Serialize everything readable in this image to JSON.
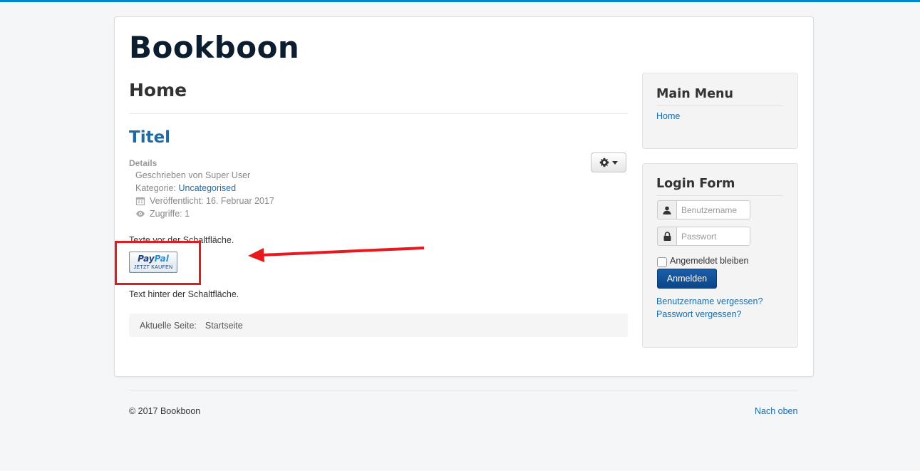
{
  "site": {
    "brand": "Bookboon"
  },
  "page": {
    "heading": "Home"
  },
  "article": {
    "title": "Titel",
    "details_label": "Details",
    "author_line": "Geschrieben von Super User",
    "category_prefix": "Kategorie: ",
    "category_link": "Uncategorised",
    "published": "Veröffentlicht: 16. Februar 2017",
    "hits": "Zugriffe: 1",
    "text_before": "Texte vor der Schaltfläche.",
    "paypal": {
      "logo_pay": "Pay",
      "logo_pal": "Pal",
      "caption": "JETZT KAUFEN"
    },
    "text_after": "Text hinter der Schaltfläche."
  },
  "breadcrumb": {
    "label": "Aktuelle Seite:",
    "current": "Startseite"
  },
  "main_menu": {
    "title": "Main Menu",
    "items": [
      {
        "label": "Home"
      }
    ]
  },
  "login_form": {
    "title": "Login Form",
    "username_placeholder": "Benutzername",
    "password_placeholder": "Passwort",
    "remember_label": "Angemeldet bleiben",
    "submit_label": "Anmelden",
    "forgot_username": "Benutzername vergessen?",
    "forgot_password": "Passwort vergessen?"
  },
  "footer": {
    "copyright": "© 2017 Bookboon",
    "back_to_top": "Nach oben"
  },
  "colors": {
    "accent": "#0088cc",
    "link": "#1e6aa6",
    "annotation": "#e8191c"
  },
  "icons": [
    "gear-icon",
    "caret-down-icon",
    "calendar-icon",
    "eye-icon",
    "user-icon",
    "lock-icon"
  ]
}
